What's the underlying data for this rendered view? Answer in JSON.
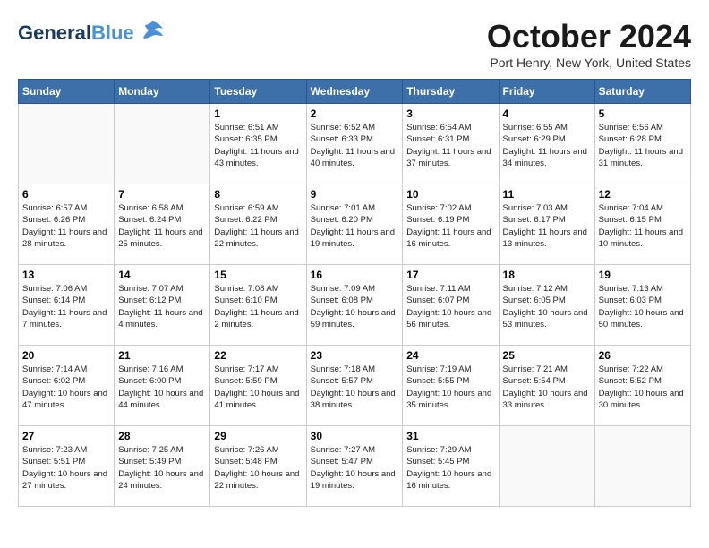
{
  "header": {
    "logo": {
      "general": "General",
      "blue": "Blue"
    },
    "title": "October 2024",
    "location": "Port Henry, New York, United States"
  },
  "days_of_week": [
    "Sunday",
    "Monday",
    "Tuesday",
    "Wednesday",
    "Thursday",
    "Friday",
    "Saturday"
  ],
  "weeks": [
    [
      {
        "day": "",
        "info": ""
      },
      {
        "day": "",
        "info": ""
      },
      {
        "day": "1",
        "info": "Sunrise: 6:51 AM\nSunset: 6:35 PM\nDaylight: 11 hours and 43 minutes."
      },
      {
        "day": "2",
        "info": "Sunrise: 6:52 AM\nSunset: 6:33 PM\nDaylight: 11 hours and 40 minutes."
      },
      {
        "day": "3",
        "info": "Sunrise: 6:54 AM\nSunset: 6:31 PM\nDaylight: 11 hours and 37 minutes."
      },
      {
        "day": "4",
        "info": "Sunrise: 6:55 AM\nSunset: 6:29 PM\nDaylight: 11 hours and 34 minutes."
      },
      {
        "day": "5",
        "info": "Sunrise: 6:56 AM\nSunset: 6:28 PM\nDaylight: 11 hours and 31 minutes."
      }
    ],
    [
      {
        "day": "6",
        "info": "Sunrise: 6:57 AM\nSunset: 6:26 PM\nDaylight: 11 hours and 28 minutes."
      },
      {
        "day": "7",
        "info": "Sunrise: 6:58 AM\nSunset: 6:24 PM\nDaylight: 11 hours and 25 minutes."
      },
      {
        "day": "8",
        "info": "Sunrise: 6:59 AM\nSunset: 6:22 PM\nDaylight: 11 hours and 22 minutes."
      },
      {
        "day": "9",
        "info": "Sunrise: 7:01 AM\nSunset: 6:20 PM\nDaylight: 11 hours and 19 minutes."
      },
      {
        "day": "10",
        "info": "Sunrise: 7:02 AM\nSunset: 6:19 PM\nDaylight: 11 hours and 16 minutes."
      },
      {
        "day": "11",
        "info": "Sunrise: 7:03 AM\nSunset: 6:17 PM\nDaylight: 11 hours and 13 minutes."
      },
      {
        "day": "12",
        "info": "Sunrise: 7:04 AM\nSunset: 6:15 PM\nDaylight: 11 hours and 10 minutes."
      }
    ],
    [
      {
        "day": "13",
        "info": "Sunrise: 7:06 AM\nSunset: 6:14 PM\nDaylight: 11 hours and 7 minutes."
      },
      {
        "day": "14",
        "info": "Sunrise: 7:07 AM\nSunset: 6:12 PM\nDaylight: 11 hours and 4 minutes."
      },
      {
        "day": "15",
        "info": "Sunrise: 7:08 AM\nSunset: 6:10 PM\nDaylight: 11 hours and 2 minutes."
      },
      {
        "day": "16",
        "info": "Sunrise: 7:09 AM\nSunset: 6:08 PM\nDaylight: 10 hours and 59 minutes."
      },
      {
        "day": "17",
        "info": "Sunrise: 7:11 AM\nSunset: 6:07 PM\nDaylight: 10 hours and 56 minutes."
      },
      {
        "day": "18",
        "info": "Sunrise: 7:12 AM\nSunset: 6:05 PM\nDaylight: 10 hours and 53 minutes."
      },
      {
        "day": "19",
        "info": "Sunrise: 7:13 AM\nSunset: 6:03 PM\nDaylight: 10 hours and 50 minutes."
      }
    ],
    [
      {
        "day": "20",
        "info": "Sunrise: 7:14 AM\nSunset: 6:02 PM\nDaylight: 10 hours and 47 minutes."
      },
      {
        "day": "21",
        "info": "Sunrise: 7:16 AM\nSunset: 6:00 PM\nDaylight: 10 hours and 44 minutes."
      },
      {
        "day": "22",
        "info": "Sunrise: 7:17 AM\nSunset: 5:59 PM\nDaylight: 10 hours and 41 minutes."
      },
      {
        "day": "23",
        "info": "Sunrise: 7:18 AM\nSunset: 5:57 PM\nDaylight: 10 hours and 38 minutes."
      },
      {
        "day": "24",
        "info": "Sunrise: 7:19 AM\nSunset: 5:55 PM\nDaylight: 10 hours and 35 minutes."
      },
      {
        "day": "25",
        "info": "Sunrise: 7:21 AM\nSunset: 5:54 PM\nDaylight: 10 hours and 33 minutes."
      },
      {
        "day": "26",
        "info": "Sunrise: 7:22 AM\nSunset: 5:52 PM\nDaylight: 10 hours and 30 minutes."
      }
    ],
    [
      {
        "day": "27",
        "info": "Sunrise: 7:23 AM\nSunset: 5:51 PM\nDaylight: 10 hours and 27 minutes."
      },
      {
        "day": "28",
        "info": "Sunrise: 7:25 AM\nSunset: 5:49 PM\nDaylight: 10 hours and 24 minutes."
      },
      {
        "day": "29",
        "info": "Sunrise: 7:26 AM\nSunset: 5:48 PM\nDaylight: 10 hours and 22 minutes."
      },
      {
        "day": "30",
        "info": "Sunrise: 7:27 AM\nSunset: 5:47 PM\nDaylight: 10 hours and 19 minutes."
      },
      {
        "day": "31",
        "info": "Sunrise: 7:29 AM\nSunset: 5:45 PM\nDaylight: 10 hours and 16 minutes."
      },
      {
        "day": "",
        "info": ""
      },
      {
        "day": "",
        "info": ""
      }
    ]
  ]
}
